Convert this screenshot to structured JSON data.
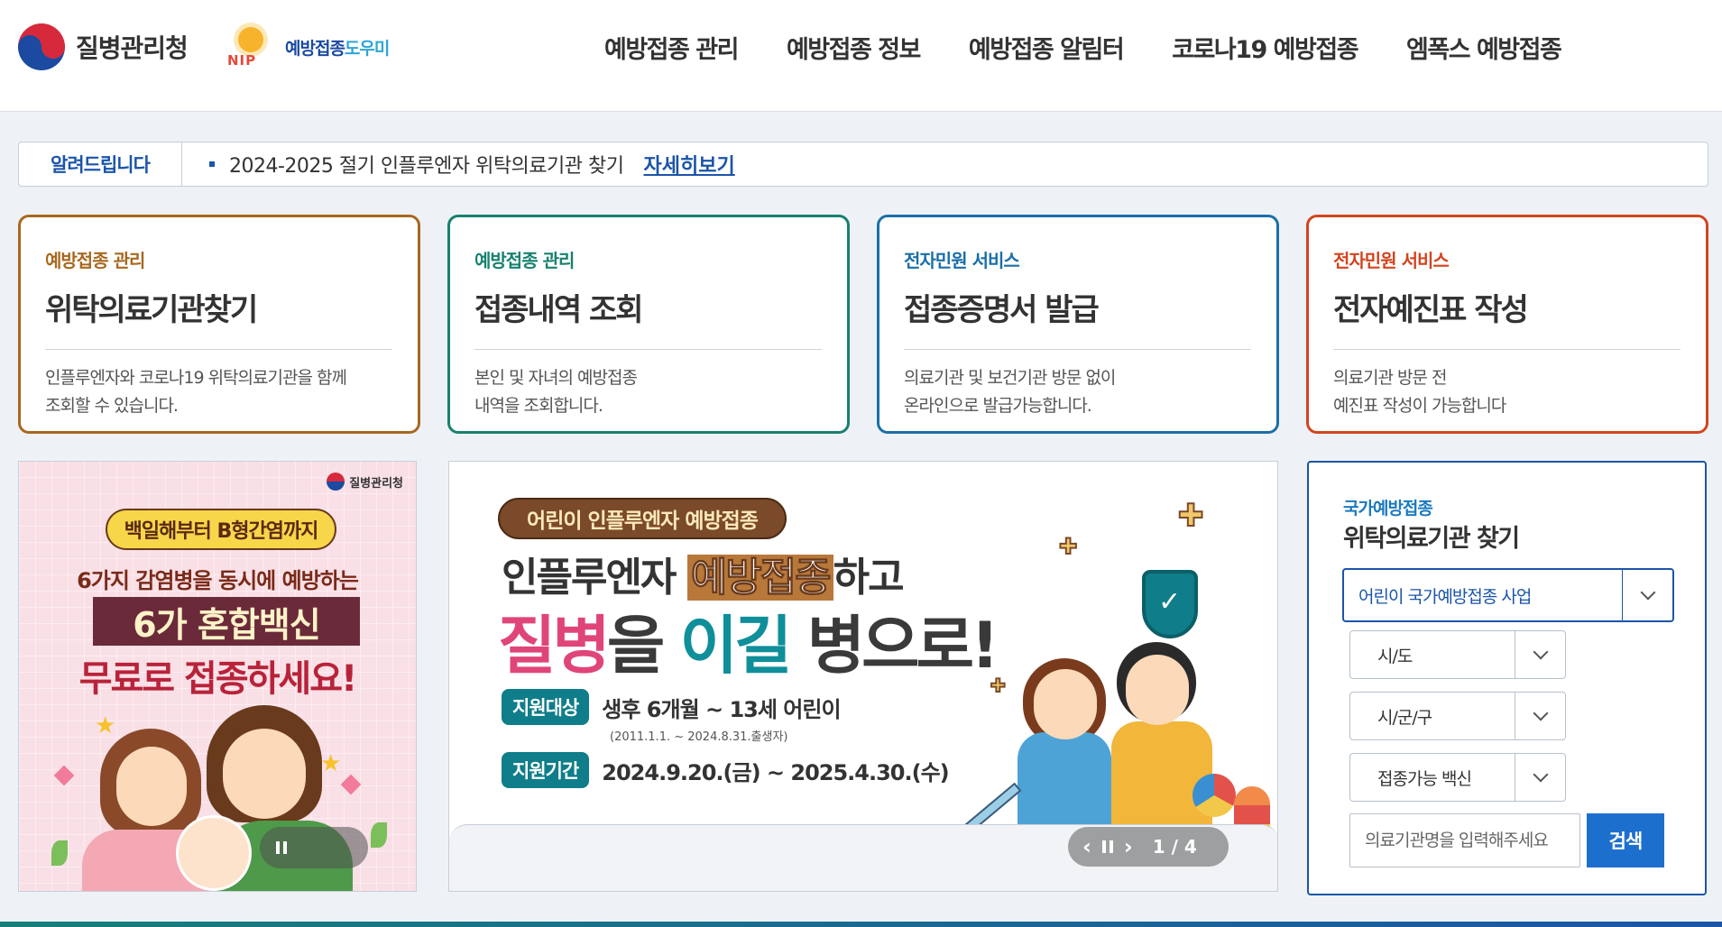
{
  "header": {
    "kdca_logo": "질병관리청",
    "nip_logo": {
      "prefix": "예방접종",
      "accent": "도우미",
      "badge": "NIP"
    },
    "nav": [
      "예방접종 관리",
      "예방접종 정보",
      "예방접종 알림터",
      "코로나19 예방접종",
      "엠폭스 예방접종"
    ]
  },
  "notice": {
    "label": "알려드립니다",
    "text": "2024-2025 절기 인플루엔자 위탁의료기관 찾기",
    "more": "자세히보기"
  },
  "cards": [
    {
      "category": "예방접종 관리",
      "title": "위탁의료기관찾기",
      "desc": [
        "인플루엔자와 코로나19 위탁의료기관을 함께",
        "조회할 수 있습니다."
      ],
      "color": "#a8681f"
    },
    {
      "category": "예방접종 관리",
      "title": "접종내역 조회",
      "desc": [
        "본인 및 자녀의 예방접종",
        "내역을 조회합니다."
      ],
      "color": "#17816f"
    },
    {
      "category": "전자민원 서비스",
      "title": "접종증명서 발급",
      "desc": [
        "의료기관 및 보건기관 방문 없이",
        "온라인으로 발급가능합니다."
      ],
      "color": "#1a6fa8"
    },
    {
      "category": "전자민원 서비스",
      "title": "전자예진표 작성",
      "desc": [
        "의료기관 방문 전",
        "예진표 작성이 가능합니다"
      ],
      "color": "#d2451f"
    }
  ],
  "banner_left": {
    "brand": "질병관리청",
    "pill": "백일해부터 B형간염까지",
    "line1": "6가지 감염병을 동시에 예방하는",
    "line2": "6가 혼합백신",
    "line3": "무료로 접종하세요!"
  },
  "banner_center": {
    "pill": "어린이 인플루엔자 예방접종",
    "line1_a": "인플루엔자 ",
    "line1_hl": "예방접종",
    "line1_b": "하고",
    "line2_a": "질병",
    "line2_b": "을 ",
    "line2_c": "이길",
    "line2_d": " 병으로!",
    "target_tag": "지원대상",
    "target_val": "생후 6개월 ~ 13세 어린이",
    "target_sub": "(2011.1.1. ~ 2024.8.31.출생자)",
    "period_tag": "지원기간",
    "period_val": "2024.9.20.(금) ~ 2025.4.30.(수)",
    "counter": "1 / 4"
  },
  "search": {
    "category": "국가예방접종",
    "title": "위탁의료기관 찾기",
    "program": "어린이 국가예방접종 사업",
    "sido": "시/도",
    "sigungu": "시/군/구",
    "vaccine": "접종가능 백신",
    "placeholder": "의료기관명을 입력해주세요",
    "button": "검색"
  }
}
